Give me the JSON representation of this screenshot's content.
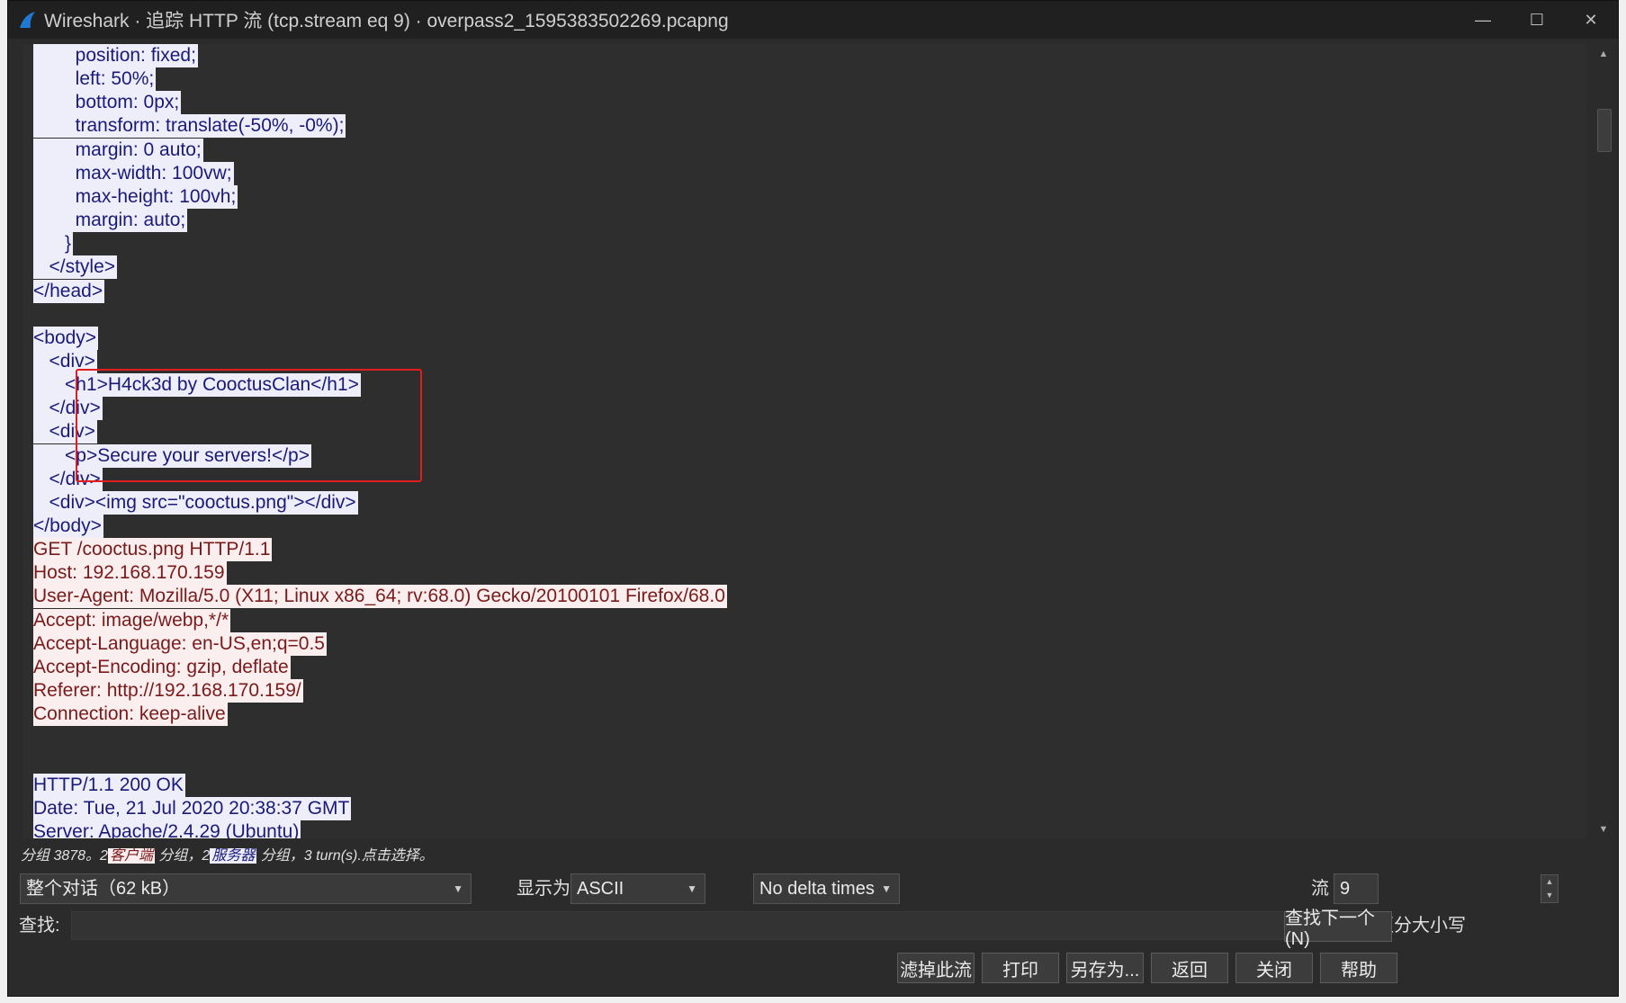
{
  "window": {
    "title": "Wireshark · 追踪 HTTP 流 (tcp.stream eq 9) · overpass2_1595383502269.pcapng",
    "controls": [
      "—",
      "☐",
      "✕"
    ]
  },
  "stream_lines": [
    {
      "dir": "srv",
      "text": "        position: fixed;"
    },
    {
      "dir": "srv",
      "text": "        left: 50%;"
    },
    {
      "dir": "srv",
      "text": "        bottom: 0px;"
    },
    {
      "dir": "srv",
      "text": "        transform: translate(-50%, -0%);"
    },
    {
      "dir": "srv",
      "text": "        margin: 0 auto;"
    },
    {
      "dir": "srv",
      "text": "        max-width: 100vw;"
    },
    {
      "dir": "srv",
      "text": "        max-height: 100vh;"
    },
    {
      "dir": "srv",
      "text": "        margin: auto;"
    },
    {
      "dir": "srv",
      "text": "      }"
    },
    {
      "dir": "srv",
      "text": "   </style>"
    },
    {
      "dir": "srv",
      "text": "</head>"
    },
    {
      "dir": "srv",
      "text": ""
    },
    {
      "dir": "srv",
      "text": "<body>"
    },
    {
      "dir": "srv",
      "text": "   <div>"
    },
    {
      "dir": "srv",
      "text": "      <h1>H4ck3d by CooctusClan</h1>"
    },
    {
      "dir": "srv",
      "text": "   </div>"
    },
    {
      "dir": "srv",
      "text": "   <div>"
    },
    {
      "dir": "srv",
      "text": "      <p>Secure your servers!</p>"
    },
    {
      "dir": "srv",
      "text": "   </div>"
    },
    {
      "dir": "srv",
      "text": "   <div><img src=\"cooctus.png\"></div>"
    },
    {
      "dir": "srv",
      "text": "</body>"
    },
    {
      "dir": "cli",
      "text": "GET /cooctus.png HTTP/1.1"
    },
    {
      "dir": "cli",
      "text": "Host: 192.168.170.159"
    },
    {
      "dir": "cli",
      "text": "User-Agent: Mozilla/5.0 (X11; Linux x86_64; rv:68.0) Gecko/20100101 Firefox/68.0"
    },
    {
      "dir": "cli",
      "text": "Accept: image/webp,*/*"
    },
    {
      "dir": "cli",
      "text": "Accept-Language: en-US,en;q=0.5"
    },
    {
      "dir": "cli",
      "text": "Accept-Encoding: gzip, deflate"
    },
    {
      "dir": "cli",
      "text": "Referer: http://192.168.170.159/"
    },
    {
      "dir": "cli",
      "text": "Connection: keep-alive"
    },
    {
      "dir": "srv",
      "text": ""
    },
    {
      "dir": "srv",
      "text": ""
    },
    {
      "dir": "srv",
      "text": "HTTP/1.1 200 OK"
    },
    {
      "dir": "srv",
      "text": "Date: Tue, 21 Jul 2020 20:38:37 GMT"
    },
    {
      "dir": "srv",
      "text": "Server: Apache/2.4.29 (Ubuntu)"
    }
  ],
  "status": {
    "prefix": "分组 3878。2",
    "client_tag": "客户端",
    "mid": " 分组，2",
    "server_tag": "服务器",
    "suffix": " 分组，3 turn(s).点击选择。"
  },
  "controls": {
    "conversation": "整个对话（62 kB）",
    "show_as_label": "显示为",
    "show_as_value": "ASCII",
    "delta": "No delta times",
    "stream_label": "流",
    "stream_value": "9",
    "find_label": "查找:",
    "find_value": "",
    "case_label": "区分大小写",
    "find_next": "查找下一个(N)"
  },
  "buttons": {
    "filter_out": "滤掉此流",
    "print": "打印",
    "save_as": "另存为...",
    "back": "返回",
    "close": "关闭",
    "help": "帮助"
  },
  "colors": {
    "server_bg": "#eeeefb",
    "server_fg": "#1a1a7a",
    "client_bg": "#fbeeee",
    "client_fg": "#7a1a1a",
    "annotation": "#e21d1d"
  }
}
